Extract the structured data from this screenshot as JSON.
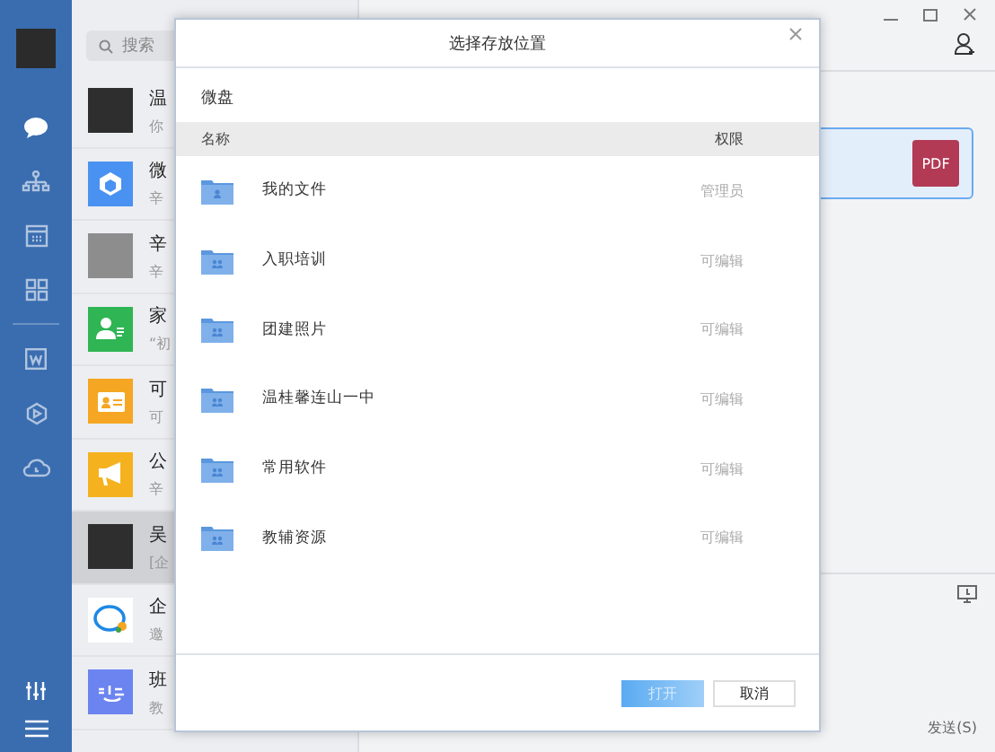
{
  "rail": {
    "items": [
      {
        "kind": "chat",
        "selected": true
      },
      {
        "kind": "org",
        "selected": false
      },
      {
        "kind": "calendar",
        "selected": false
      },
      {
        "kind": "apps",
        "selected": false
      },
      {
        "kind": "doc",
        "selected": false
      },
      {
        "kind": "video",
        "selected": false
      },
      {
        "kind": "cloud",
        "selected": false
      }
    ]
  },
  "chat_list": {
    "search": {
      "placeholder": "搜索"
    },
    "items": [
      {
        "name": "温",
        "preview": "你",
        "kind": "photo",
        "selected": false
      },
      {
        "name": "微",
        "preview": "辛",
        "kind": "drive",
        "selected": false
      },
      {
        "name": "辛",
        "preview": "辛",
        "kind": "group",
        "selected": false
      },
      {
        "name": "家",
        "preview": "“初",
        "kind": "contact",
        "selected": false
      },
      {
        "name": "可",
        "preview": "可",
        "kind": "card",
        "selected": false
      },
      {
        "name": "公",
        "preview": "辛",
        "kind": "notice",
        "selected": false
      },
      {
        "name": "吴",
        "preview": "[企",
        "kind": "photo",
        "selected": true
      },
      {
        "name": "企",
        "preview": "邀",
        "kind": "bubble",
        "selected": false
      },
      {
        "name": "班",
        "preview": "教",
        "kind": "class",
        "selected": false
      }
    ]
  },
  "chat": {
    "file": {
      "badge": "PDF"
    },
    "send_button": "发送(S)"
  },
  "dialog": {
    "title": "选择存放位置",
    "breadcrumb": "微盘",
    "columns": [
      "名称",
      "权限"
    ],
    "rows": [
      {
        "name": "我的文件",
        "permission": "管理员",
        "kind": "personal"
      },
      {
        "name": "入职培训",
        "permission": "可编辑",
        "kind": "shared"
      },
      {
        "name": "团建照片",
        "permission": "可编辑",
        "kind": "shared"
      },
      {
        "name": "温桂馨连山一中",
        "permission": "可编辑",
        "kind": "shared"
      },
      {
        "name": "常用软件",
        "permission": "可编辑",
        "kind": "shared"
      },
      {
        "name": "教辅资源",
        "permission": "可编辑",
        "kind": "shared"
      }
    ],
    "buttons": [
      {
        "label": "打开",
        "disabled": true
      },
      {
        "label": "取消",
        "disabled": false
      }
    ]
  }
}
